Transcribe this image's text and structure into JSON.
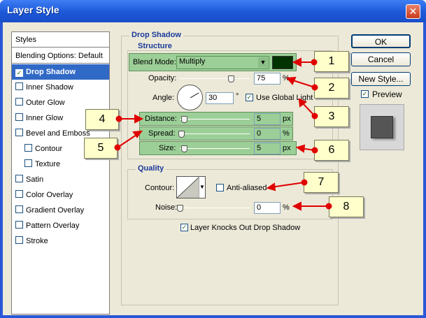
{
  "window": {
    "title": "Layer Style"
  },
  "styles_list": {
    "header": "Styles",
    "blending": "Blending Options: Default",
    "items": [
      {
        "label": "Drop Shadow",
        "checked": true,
        "selected": true
      },
      {
        "label": "Inner Shadow",
        "checked": false
      },
      {
        "label": "Outer Glow",
        "checked": false
      },
      {
        "label": "Inner Glow",
        "checked": false
      },
      {
        "label": "Bevel and Emboss",
        "checked": false
      },
      {
        "label": "Contour",
        "checked": false,
        "sub": true
      },
      {
        "label": "Texture",
        "checked": false,
        "sub": true
      },
      {
        "label": "Satin",
        "checked": false
      },
      {
        "label": "Color Overlay",
        "checked": false
      },
      {
        "label": "Gradient Overlay",
        "checked": false
      },
      {
        "label": "Pattern Overlay",
        "checked": false
      },
      {
        "label": "Stroke",
        "checked": false
      }
    ]
  },
  "drop_shadow": {
    "group_title": "Drop Shadow",
    "structure_title": "Structure",
    "blend_mode_label": "Blend Mode:",
    "blend_mode_value": "Multiply",
    "shadow_color": "#003300",
    "opacity_label": "Opacity:",
    "opacity_value": "75",
    "opacity_unit": "%",
    "angle_label": "Angle:",
    "angle_value": "30",
    "angle_unit": "°",
    "global_light_label": "Use Global Light",
    "distance_label": "Distance:",
    "distance_value": "5",
    "distance_unit": "px",
    "spread_label": "Spread:",
    "spread_value": "0",
    "spread_unit": "%",
    "size_label": "Size:",
    "size_value": "5",
    "size_unit": "px",
    "quality_title": "Quality",
    "contour_label": "Contour:",
    "anti_aliased_label": "Anti-aliased",
    "noise_label": "Noise:",
    "noise_value": "0",
    "noise_unit": "%",
    "knockout_label": "Layer Knocks Out Drop Shadow"
  },
  "buttons": {
    "ok": "OK",
    "cancel": "Cancel",
    "new_style": "New Style...",
    "preview": "Preview"
  },
  "callouts": [
    "1",
    "2",
    "3",
    "4",
    "5",
    "6",
    "7",
    "8"
  ],
  "colors": {
    "green_highlight": "#9ccf97",
    "arrow": "#e00000",
    "selection": "#3169c6"
  }
}
